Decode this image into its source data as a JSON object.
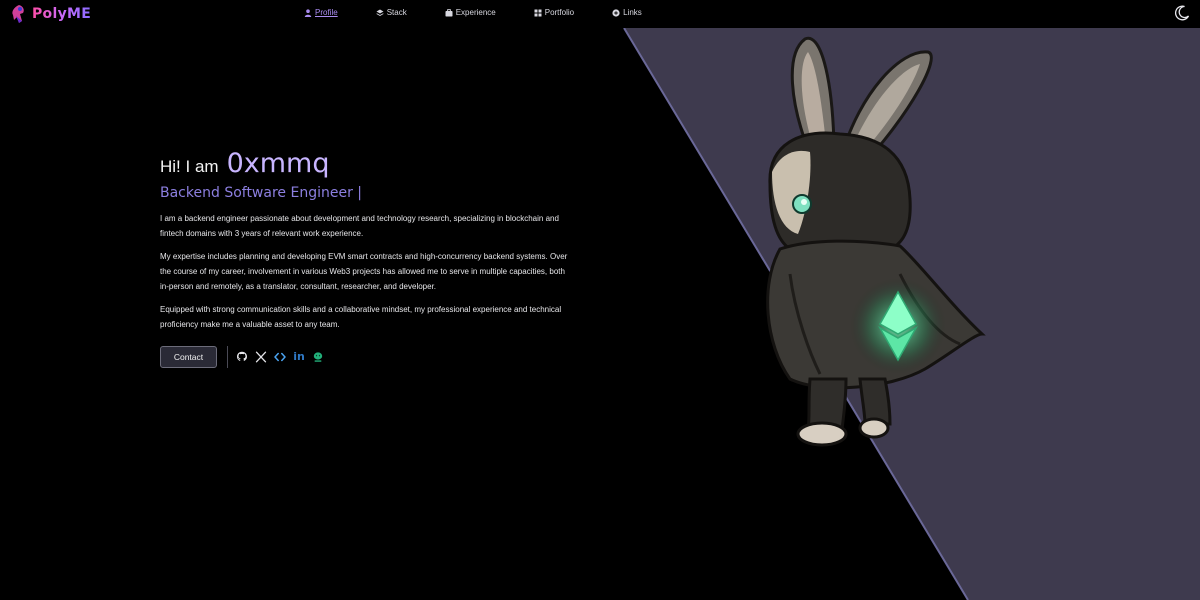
{
  "brand": {
    "name": "PolyME"
  },
  "nav": {
    "items": [
      {
        "label": "Profile",
        "icon": "user-icon",
        "active": true
      },
      {
        "label": "Stack",
        "icon": "layers-icon",
        "active": false
      },
      {
        "label": "Experience",
        "icon": "briefcase-icon",
        "active": false
      },
      {
        "label": "Portfolio",
        "icon": "grid-icon",
        "active": false
      },
      {
        "label": "Links",
        "icon": "link-icon",
        "active": false
      }
    ]
  },
  "theme_toggle": {
    "icon": "moon-icon"
  },
  "hero": {
    "greeting_prefix": "Hi! I am",
    "name": "0xmmq",
    "role": "Backend Software Engineer |",
    "paragraphs": [
      "I am a backend engineer passionate about development and technology research, specializing in blockchain and fintech domains with 3 years of relevant work experience.",
      "My expertise includes planning and developing EVM smart contracts and high-concurrency backend systems. Over the course of my career, involvement in various Web3 projects has allowed me to serve in multiple capacities, both in-person and remotely, as a translator, consultant, researcher, and developer.",
      "Equipped with strong communication skills and a collaborative mindset, my professional experience and technical proficiency make me a valuable asset to any team."
    ],
    "contact_label": "Contact",
    "socials": [
      {
        "name": "github",
        "icon": "github-icon"
      },
      {
        "name": "x",
        "icon": "x-icon"
      },
      {
        "name": "code",
        "icon": "code-icon"
      },
      {
        "name": "linkedin",
        "label": "in",
        "icon": "linkedin-icon"
      },
      {
        "name": "coinmarketcap",
        "icon": "cake-icon"
      }
    ]
  },
  "colors": {
    "background": "#000000",
    "panel": "#3e3a4e",
    "accent": "#a98cf0",
    "name": "#c8b5ff",
    "role": "#8c7fe0",
    "eth_glow": "#57e0a0"
  }
}
